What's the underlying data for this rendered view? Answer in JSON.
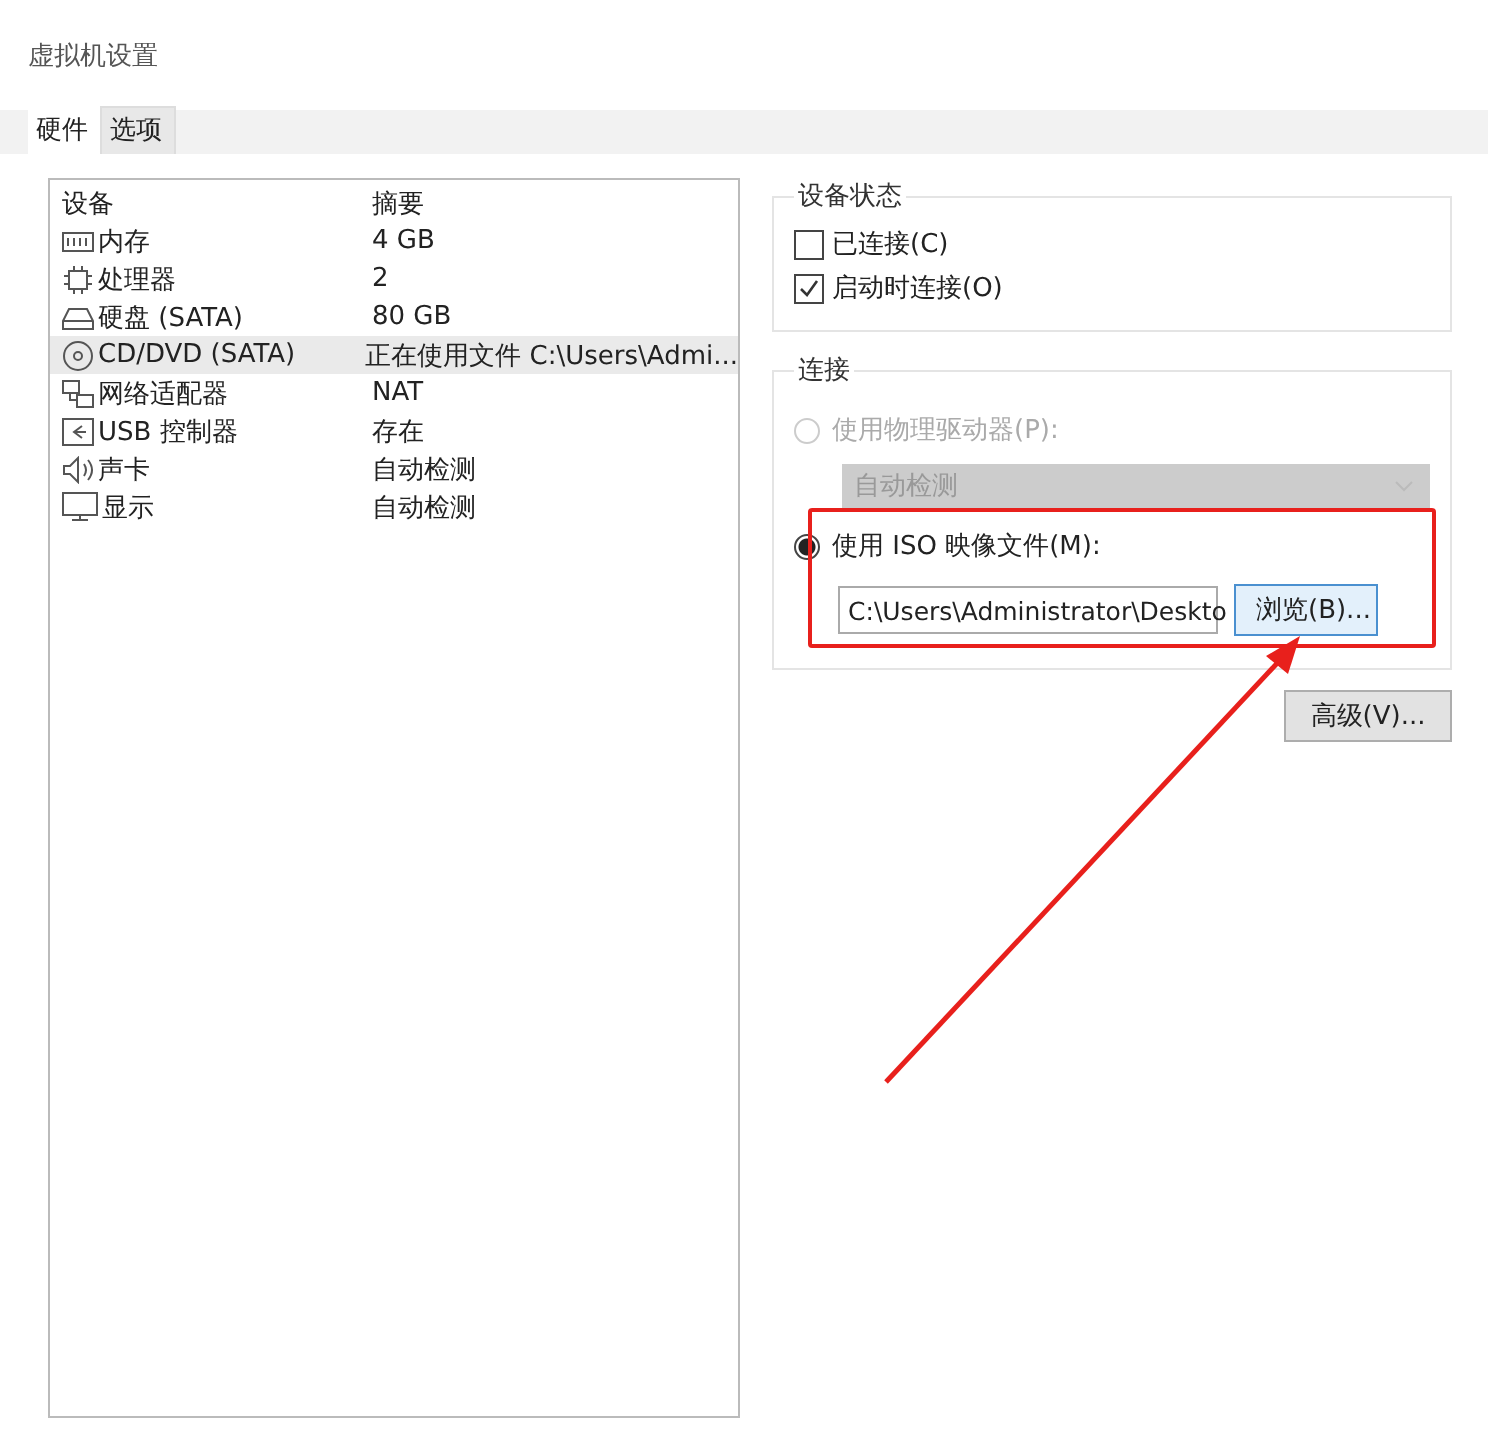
{
  "window": {
    "title": "虚拟机设置"
  },
  "tabs": [
    {
      "label": "硬件",
      "selected": true
    },
    {
      "label": "选项",
      "selected": false
    }
  ],
  "device_table": {
    "columns": [
      "设备",
      "摘要"
    ],
    "rows": [
      {
        "kind": "memory",
        "device": "内存",
        "summary": "4 GB",
        "selected": false
      },
      {
        "kind": "cpu",
        "device": "处理器",
        "summary": "2",
        "selected": false
      },
      {
        "kind": "disk",
        "device": "硬盘 (SATA)",
        "summary": "80 GB",
        "selected": false
      },
      {
        "kind": "cd",
        "device": "CD/DVD (SATA)",
        "summary": "正在使用文件 C:\\Users\\Admi...",
        "selected": true
      },
      {
        "kind": "network",
        "device": "网络适配器",
        "summary": "NAT",
        "selected": false
      },
      {
        "kind": "usb",
        "device": "USB 控制器",
        "summary": "存在",
        "selected": false
      },
      {
        "kind": "sound",
        "device": "声卡",
        "summary": "自动检测",
        "selected": false
      },
      {
        "kind": "display",
        "device": "显示",
        "summary": "自动检测",
        "selected": false
      }
    ]
  },
  "device_status": {
    "title": "设备状态",
    "checkboxes": [
      {
        "label": "已连接(C)",
        "checked": false
      },
      {
        "label": "启动时连接(O)",
        "checked": true
      }
    ]
  },
  "connection": {
    "title": "连接",
    "options": [
      {
        "kind": "drive",
        "label": "使用物理驱动器(P):",
        "selected": false,
        "disabled": true,
        "dropdown": "自动检测"
      },
      {
        "kind": "iso",
        "label": "使用 ISO 映像文件(M):",
        "selected": true,
        "disabled": false,
        "path": "C:\\Users\\Administrator\\Deskto",
        "button": "浏览(B)..."
      }
    ]
  },
  "advanced_button": "高级(V)...",
  "highlight_box": true,
  "pointer_arrow": true
}
